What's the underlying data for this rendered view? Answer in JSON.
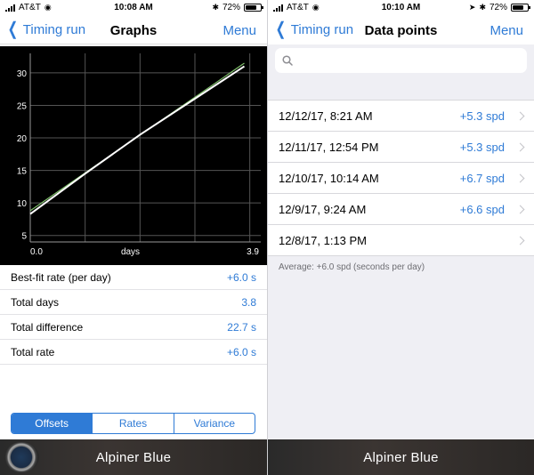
{
  "left": {
    "status": {
      "carrier": "AT&T",
      "time": "10:08 AM",
      "battery": "72%",
      "battery_level": 0.72
    },
    "nav": {
      "back_label": "Timing run",
      "title": "Graphs",
      "menu_label": "Menu"
    },
    "stats": [
      {
        "label": "Best-fit rate (per day)",
        "value": "+6.0 s"
      },
      {
        "label": "Total days",
        "value": "3.8"
      },
      {
        "label": "Total difference",
        "value": "22.7 s"
      },
      {
        "label": "Total rate",
        "value": "+6.0 s"
      }
    ],
    "segments": [
      {
        "label": "Offsets",
        "active": true
      },
      {
        "label": "Rates",
        "active": false
      },
      {
        "label": "Variance",
        "active": false
      }
    ],
    "banner": {
      "label": "Alpiner Blue"
    }
  },
  "right": {
    "status": {
      "carrier": "AT&T",
      "time": "10:10 AM",
      "battery": "72%",
      "battery_level": 0.72
    },
    "nav": {
      "back_label": "Timing run",
      "title": "Data points",
      "menu_label": "Menu"
    },
    "search": {
      "placeholder": ""
    },
    "items": [
      {
        "date": "12/12/17, 8:21 AM",
        "rate": "+5.3 spd"
      },
      {
        "date": "12/11/17, 12:54 PM",
        "rate": "+5.3 spd"
      },
      {
        "date": "12/10/17, 10:14 AM",
        "rate": "+6.7 spd"
      },
      {
        "date": "12/9/17, 9:24 AM",
        "rate": "+6.6 spd"
      },
      {
        "date": "12/8/17, 1:13 PM",
        "rate": ""
      }
    ],
    "footnote": "Average: +6.0 spd (seconds per day)",
    "banner": {
      "label": "Alpiner Blue"
    }
  },
  "colors": {
    "accent": "#2f7bd6",
    "chart_bg": "#000000",
    "fit_line": "#7fbf6a",
    "data_line": "#ffffff"
  },
  "chart_data": {
    "type": "line",
    "title": "",
    "xlabel": "days",
    "ylabel": "",
    "xlim": [
      0,
      4.2
    ],
    "ylim": [
      4,
      33
    ],
    "x_tick_labels": [
      "0.0",
      "3.9"
    ],
    "yticks": [
      5,
      10,
      15,
      20,
      25,
      30
    ],
    "grid": true,
    "series": [
      {
        "values": [
          [
            0.0,
            8.3
          ],
          [
            1.0,
            14.5
          ],
          [
            2.0,
            20.5
          ],
          [
            3.9,
            31.0
          ]
        ],
        "color": "#ffffff"
      },
      {
        "values": [
          [
            0.0,
            8.8
          ],
          [
            3.9,
            31.5
          ]
        ],
        "color": "#7fbf6a"
      }
    ]
  }
}
